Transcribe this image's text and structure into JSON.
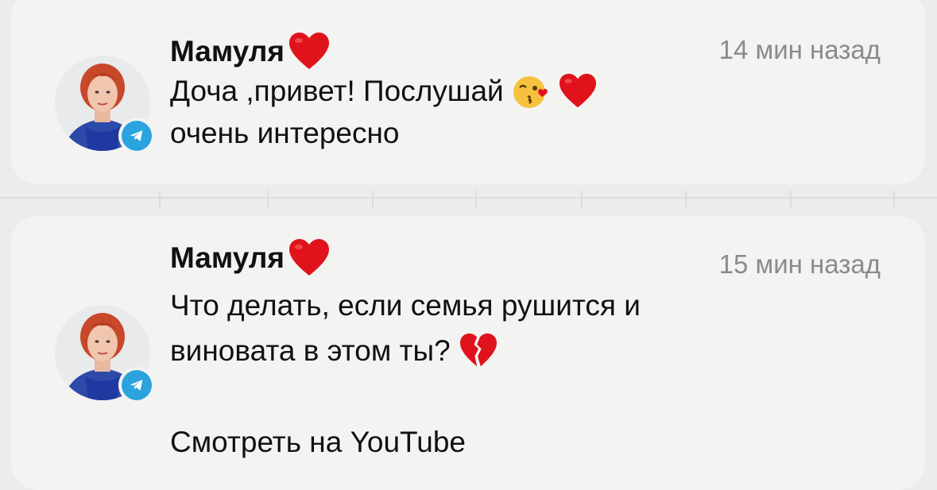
{
  "notifications": [
    {
      "sender": "Мамуля",
      "sender_emoji_icon": "red-heart-icon",
      "time": "14 мин назад",
      "message_line1": "Доча ,привет! Послушай",
      "message_line1_emojis": [
        "kissing-face-icon",
        "red-heart-icon"
      ],
      "message_line2": "очень интересно",
      "badge_icon": "telegram-icon"
    },
    {
      "sender": "Мамуля",
      "sender_emoji_icon": "red-heart-icon",
      "time": "15 мин назад",
      "message_line1": "Что делать, если семья рушится и",
      "message_line2": "виновата в этом ты?",
      "message_line2_emojis": [
        "broken-heart-icon"
      ],
      "link_text": "Смотреть на YouTube",
      "badge_icon": "telegram-icon"
    }
  ],
  "colors": {
    "background": "#ececeb",
    "card": "#f3f3f2",
    "text": "#111111",
    "time": "#8a8a8f",
    "heart": "#e0131c",
    "telegram": "#2aa3de"
  }
}
